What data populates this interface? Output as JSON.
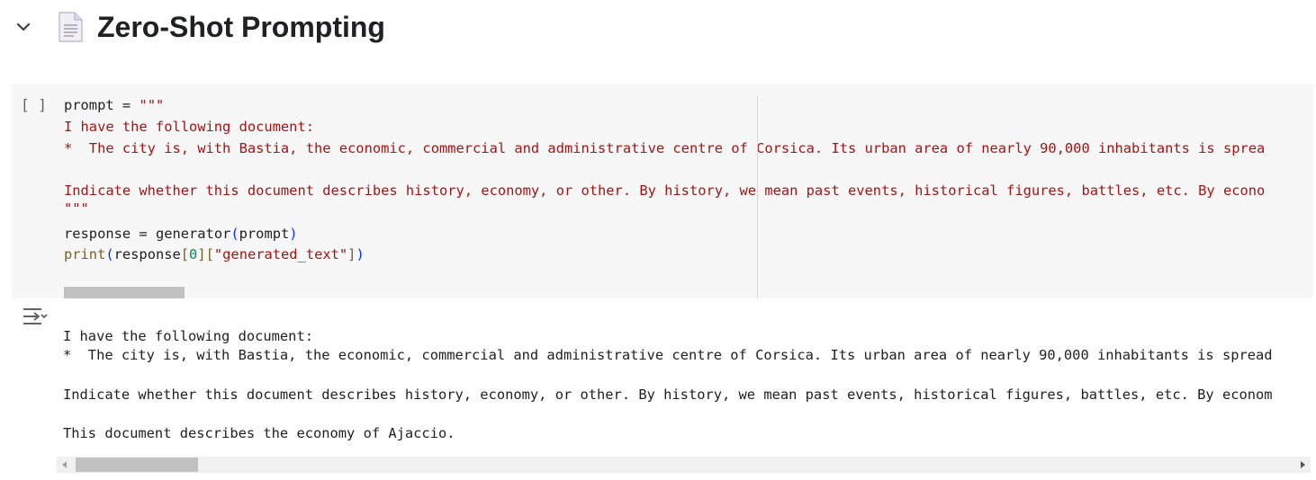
{
  "section": {
    "title": "Zero-Shot Prompting",
    "toggle_icon": "chevron-down-icon",
    "doc_icon": "document-icon"
  },
  "code_cell": {
    "run_indicator": "[ ]",
    "lines": {
      "l1_var": "prompt",
      "l1_op": " = ",
      "l1_str": "\"\"\"",
      "l2": "I have the following document:",
      "l3": "*  The city is, with Bastia, the economic, commercial and administrative centre of Corsica. Its urban area of nearly 90,000 inhabitants is sprea",
      "l5": "Indicate whether this document describes history, economy, or other. By history, we mean past events, historical figures, battles, etc. By econo",
      "l6": "\"\"\"",
      "l8_var": "response",
      "l8_op": " = ",
      "l8_fn": "generator",
      "l8_open": "(",
      "l8_arg": "prompt",
      "l8_close": ")",
      "l9_fn": "print",
      "l9_open": "(",
      "l9_var": "response",
      "l9_b1o": "[",
      "l9_idx": "0",
      "l9_b1c": "]",
      "l9_b2o": "[",
      "l9_key": "\"generated_text\"",
      "l9_b2c": "]",
      "l9_close": ")"
    }
  },
  "output": {
    "icon": "output-actions-icon",
    "lines": {
      "o1": "I have the following document:",
      "o2": "*  The city is, with Bastia, the economic, commercial and administrative centre of Corsica. Its urban area of nearly 90,000 inhabitants is spread",
      "o4": "Indicate whether this document describes history, economy, or other. By history, we mean past events, historical figures, battles, etc. By econom",
      "o6": "This document describes the economy of Ajaccio."
    }
  },
  "colors": {
    "string": "#a31515",
    "function": "#795e26",
    "bracket": "#0431fa",
    "number": "#098658",
    "cell_background": "#f7f7f7"
  }
}
